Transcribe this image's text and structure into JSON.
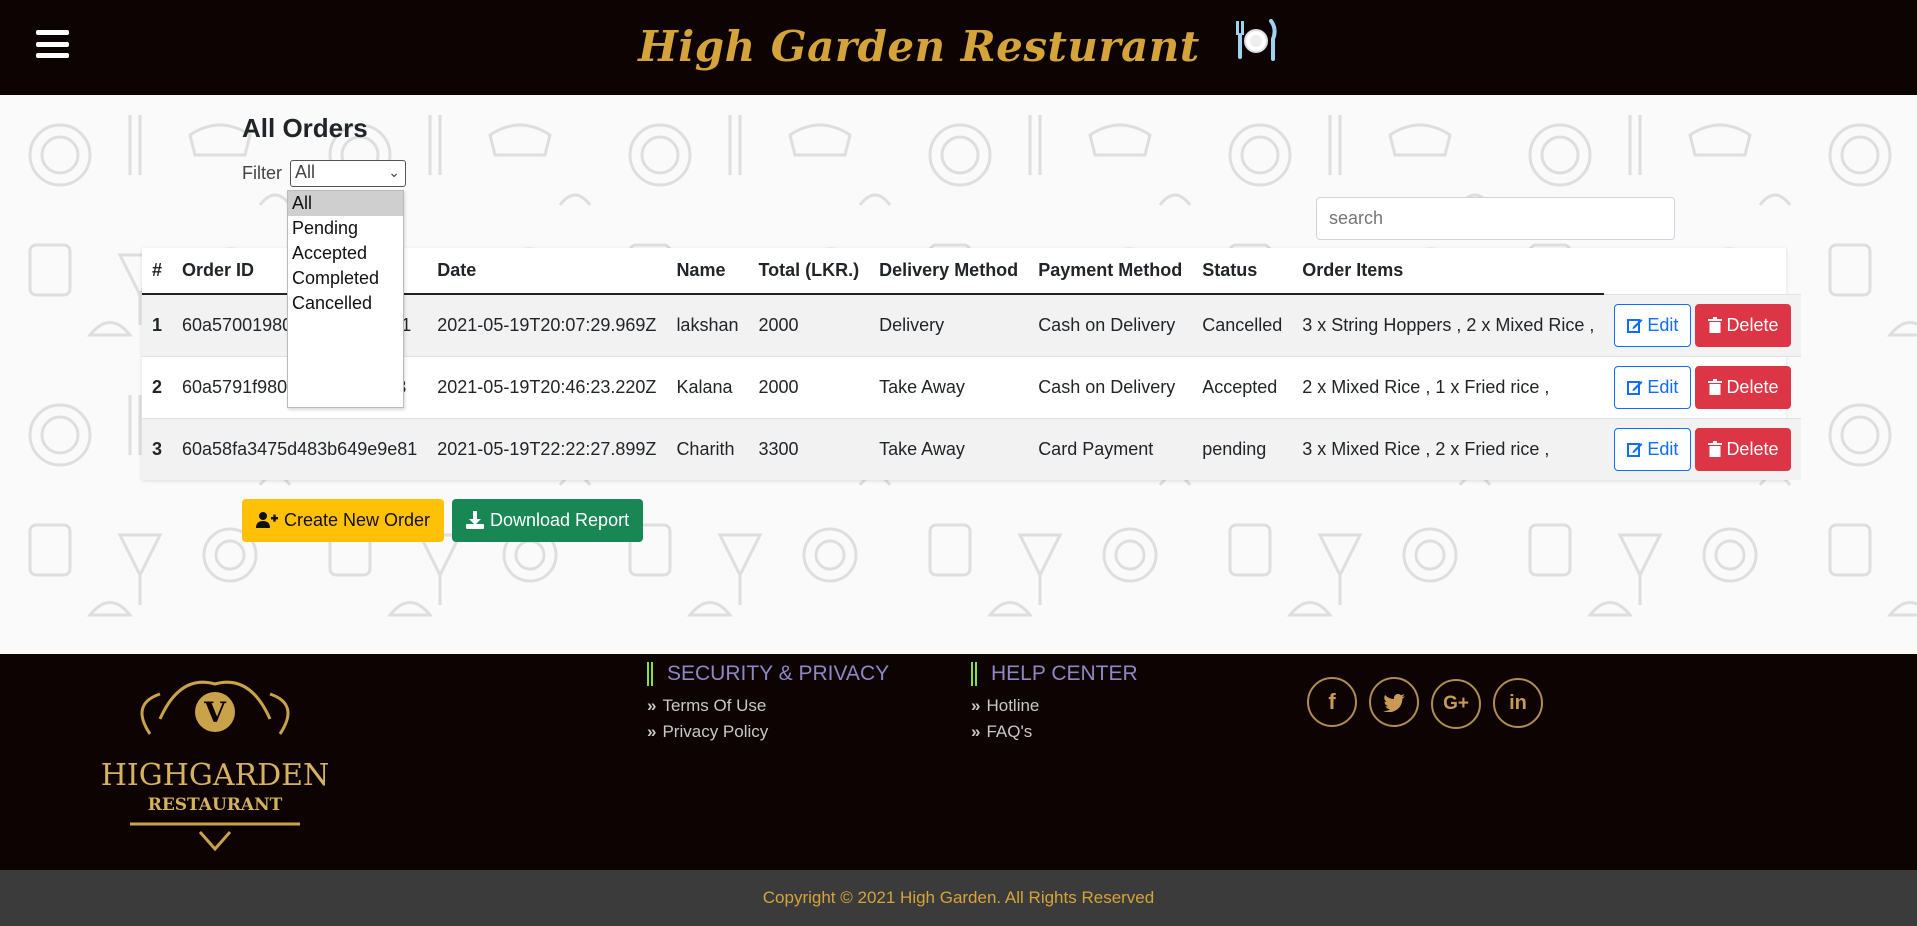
{
  "header": {
    "menu_icon": "hamburger-icon",
    "brand_title": "High Garden Resturant",
    "brand_icon": "plate-cutlery-icon"
  },
  "main": {
    "page_title": "All Orders",
    "filter": {
      "label": "Filter",
      "selected": "All",
      "options": [
        "All",
        "Pending",
        "Accepted",
        "Completed",
        "Cancelled"
      ]
    },
    "search": {
      "placeholder": "search",
      "value": ""
    },
    "table": {
      "columns": [
        "#",
        "Order ID",
        "Date",
        "Name",
        "Total (LKR.)",
        "Delivery Method",
        "Payment Method",
        "Status",
        "Order Items"
      ],
      "rows": [
        {
          "num": "1",
          "order_id": "60a57001980f3b0fb076ceb1",
          "date": "2021-05-19T20:07:29.969Z",
          "name": "lakshan",
          "total": "2000",
          "delivery": "Delivery",
          "payment": "Cash on Delivery",
          "status": "Cancelled",
          "items": "3 x String Hoppers , 2 x Mixed Rice ,"
        },
        {
          "num": "2",
          "order_id": "60a5791f980f3b0fb076ceb3",
          "date": "2021-05-19T20:46:23.220Z",
          "name": "Kalana",
          "total": "2000",
          "delivery": "Take Away",
          "payment": "Cash on Delivery",
          "status": "Accepted",
          "items": "2 x Mixed Rice , 1 x Fried rice ,"
        },
        {
          "num": "3",
          "order_id": "60a58fa3475d483b649e9e81",
          "date": "2021-05-19T22:22:27.899Z",
          "name": "Charith",
          "total": "3300",
          "delivery": "Take Away",
          "payment": "Card Payment",
          "status": "pending",
          "items": "3 x Mixed Rice , 2 x Fried rice ,"
        }
      ],
      "edit_label": "Edit",
      "delete_label": "Delete"
    },
    "create_label": "Create New Order",
    "download_label": "Download Report"
  },
  "footer": {
    "logo_letter": "V",
    "logo_name": "HIGHGARDEN",
    "logo_sub": "RESTAURANT",
    "security": {
      "heading": "SECURITY & PRIVACY",
      "links": [
        "Terms Of Use",
        "Privacy Policy"
      ]
    },
    "help": {
      "heading": "HELP CENTER",
      "links": [
        "Hotline",
        "FAQ's"
      ]
    },
    "socials": [
      "facebook-icon",
      "twitter-icon",
      "google-plus-icon",
      "linkedin-icon"
    ],
    "copyright": "Copyright © 2021 High Garden. All Rights Reserved"
  },
  "colors": {
    "header_bg": "#0d0303",
    "brand_gold": "#d4a43a",
    "edit_blue": "#0d6efd",
    "delete_red": "#dc3545",
    "create_yellow": "#ffc107",
    "download_green": "#198754",
    "footer_heading": "#8d87c4",
    "copyright_bar": "#3b3b3b"
  }
}
